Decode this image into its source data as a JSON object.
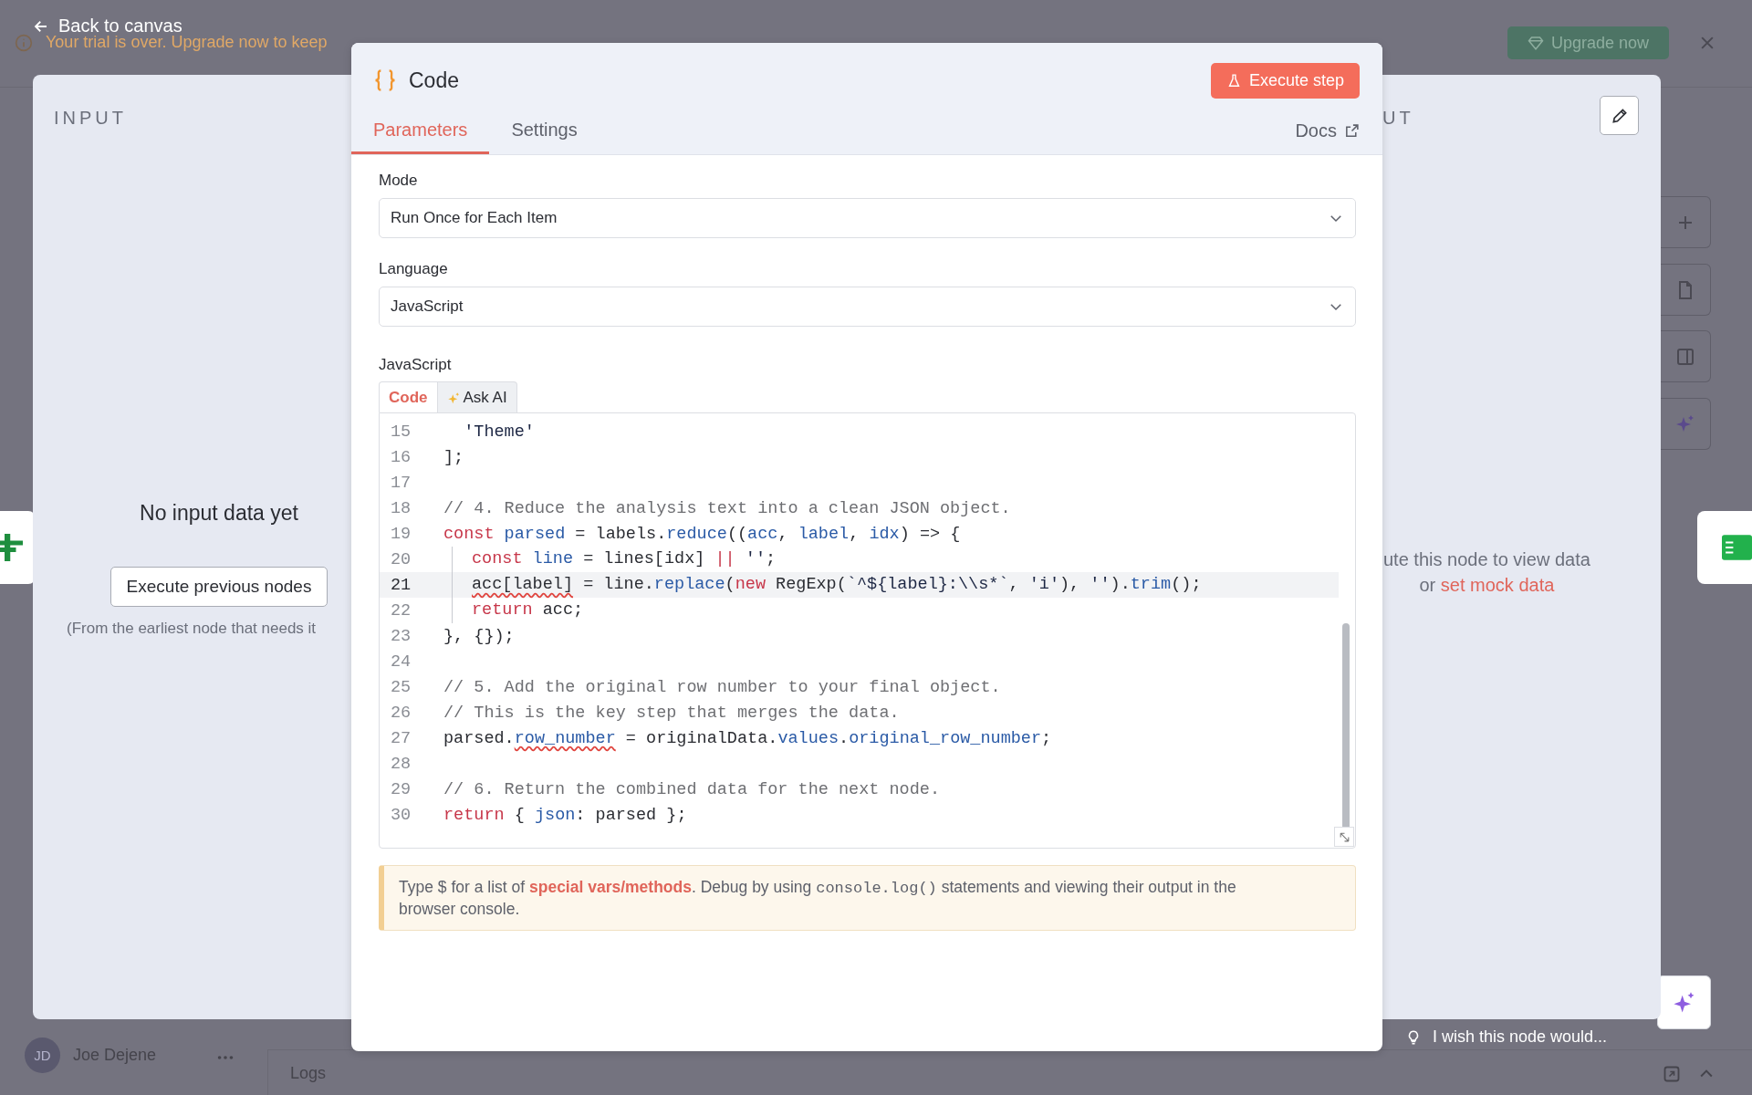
{
  "backdrop": {
    "back_link": "Back to canvas",
    "banner": {
      "message": "Your trial is over. Upgrade now to keep",
      "button": "Upgrade now"
    },
    "user": {
      "initials": "JD",
      "name": "Joe Dejene"
    },
    "logs": "Logs",
    "feedback": "I wish this node would..."
  },
  "input_panel": {
    "title": "INPUT",
    "empty_title": "No input data yet",
    "button": "Execute previous nodes",
    "note": "(From the earliest node that needs it"
  },
  "output_panel": {
    "title": "UT",
    "message": "ute this node to view data",
    "link_prefix": "or ",
    "link": "set mock data"
  },
  "modal": {
    "title": "Code",
    "execute_button": "Execute step",
    "tabs": [
      {
        "label": "Parameters",
        "selected": true
      },
      {
        "label": "Settings",
        "selected": false
      }
    ],
    "docs": "Docs",
    "fields": [
      {
        "label": "Mode",
        "value": "Run Once for Each Item"
      },
      {
        "label": "Language",
        "value": "JavaScript"
      }
    ],
    "editor": {
      "label": "JavaScript",
      "tabs": [
        {
          "label": "Code",
          "selected": true
        },
        {
          "label": "Ask AI",
          "selected": false
        }
      ],
      "lines": [
        {
          "number": "15",
          "selected": false,
          "tokens": [
            {
              "kind": "string",
              "text": "  'Theme'"
            }
          ]
        },
        {
          "number": "16",
          "selected": false,
          "tokens": [
            {
              "kind": "plain",
              "text": "];"
            }
          ]
        },
        {
          "number": "17",
          "selected": false
        },
        {
          "number": "18",
          "selected": false,
          "tokens": [
            {
              "kind": "comment",
              "text": "// 4. Reduce the analysis text into a clean JSON object."
            }
          ]
        },
        {
          "number": "19",
          "selected": false,
          "tokens": [
            {
              "kind": "keyword",
              "text": "const"
            },
            {
              "kind": "name",
              "text": " parsed"
            },
            {
              "kind": "plain",
              "text": " = labels."
            },
            {
              "kind": "name",
              "text": "reduce"
            },
            {
              "kind": "plain",
              "text": "(("
            },
            {
              "kind": "name",
              "text": "acc"
            },
            {
              "kind": "plain",
              "text": ", "
            },
            {
              "kind": "name",
              "text": "label"
            },
            {
              "kind": "plain",
              "text": ", "
            },
            {
              "kind": "name",
              "text": "idx"
            },
            {
              "kind": "plain",
              "text": ") => {"
            }
          ]
        },
        {
          "number": "20",
          "selected": false,
          "in_block": true,
          "tokens": [
            {
              "kind": "keyword",
              "text": "const"
            },
            {
              "kind": "name",
              "text": " line"
            },
            {
              "kind": "plain",
              "text": " = lines[idx] "
            },
            {
              "kind": "keyword",
              "text": "||"
            },
            {
              "kind": "string",
              "text": " ''"
            },
            {
              "kind": "plain",
              "text": ";"
            }
          ]
        },
        {
          "number": "21",
          "selected": true,
          "in_block": true,
          "tokens": [
            {
              "kind": "flagged-plain",
              "text": "acc[label]"
            },
            {
              "kind": "plain",
              "text": " = line."
            },
            {
              "kind": "name",
              "text": "replace"
            },
            {
              "kind": "plain",
              "text": "("
            },
            {
              "kind": "keyword",
              "text": "new"
            },
            {
              "kind": "plain",
              "text": " RegExp("
            },
            {
              "kind": "string",
              "text": "`^${label}:\\\\s*`"
            },
            {
              "kind": "plain",
              "text": ", "
            },
            {
              "kind": "string",
              "text": "'i'"
            },
            {
              "kind": "plain",
              "text": "), "
            },
            {
              "kind": "string",
              "text": "''"
            },
            {
              "kind": "plain",
              "text": ")."
            },
            {
              "kind": "name",
              "text": "trim"
            },
            {
              "kind": "plain",
              "text": "();"
            }
          ]
        },
        {
          "number": "22",
          "selected": false,
          "in_block": true,
          "tokens": [
            {
              "kind": "keyword",
              "text": "return"
            },
            {
              "kind": "plain",
              "text": " acc;"
            }
          ]
        },
        {
          "number": "23",
          "selected": false,
          "tokens": [
            {
              "kind": "plain",
              "text": "}, {});"
            }
          ]
        },
        {
          "number": "24",
          "selected": false
        },
        {
          "number": "25",
          "selected": false,
          "tokens": [
            {
              "kind": "comment",
              "text": "// 5. Add the original row number to your final object."
            }
          ]
        },
        {
          "number": "26",
          "selected": false,
          "tokens": [
            {
              "kind": "comment",
              "text": "// This is the key step that merges the data."
            }
          ]
        },
        {
          "number": "27",
          "selected": false,
          "tokens": [
            {
              "kind": "plain",
              "text": "parsed."
            },
            {
              "kind": "flagged-name",
              "text": "row_number"
            },
            {
              "kind": "plain",
              "text": " = originalData."
            },
            {
              "kind": "name",
              "text": "values"
            },
            {
              "kind": "plain",
              "text": "."
            },
            {
              "kind": "name",
              "text": "original_row_number"
            },
            {
              "kind": "plain",
              "text": ";"
            }
          ]
        },
        {
          "number": "28",
          "selected": false
        },
        {
          "number": "29",
          "selected": false,
          "tokens": [
            {
              "kind": "comment",
              "text": "// 6. Return the combined data for the next node."
            }
          ]
        },
        {
          "number": "30",
          "selected": false,
          "tokens": [
            {
              "kind": "keyword",
              "text": "return"
            },
            {
              "kind": "plain",
              "text": " { "
            },
            {
              "kind": "name",
              "text": "json"
            },
            {
              "kind": "plain",
              "text": ": parsed };"
            }
          ]
        }
      ]
    },
    "hint": {
      "before": "Type $ for a list of ",
      "link": "special vars/methods",
      "middle": ". Debug by using ",
      "code": "console.log()",
      "after": " statements and viewing their output in the browser console."
    }
  }
}
